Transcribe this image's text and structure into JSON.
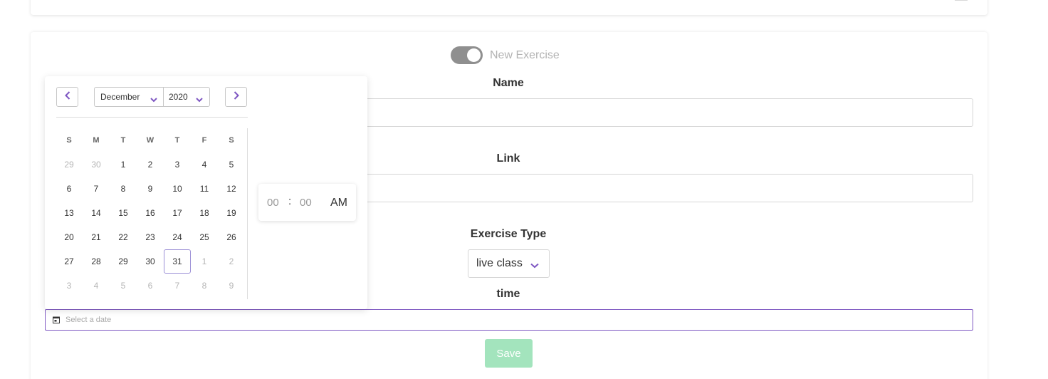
{
  "form": {
    "toggle_label": "New Exercise",
    "name_label": "Name",
    "name_value": "",
    "link_label": "Link",
    "link_value": "",
    "exercise_type_label": "Exercise Type",
    "exercise_type_value": "live class",
    "time_label": "time",
    "date_placeholder": "Select a date",
    "save_label": "Save"
  },
  "datepicker": {
    "month": "December",
    "year": "2020",
    "weekdays": [
      "S",
      "M",
      "T",
      "W",
      "T",
      "F",
      "S"
    ],
    "weeks": [
      [
        "29",
        "30",
        "1",
        "2",
        "3",
        "4",
        "5"
      ],
      [
        "6",
        "7",
        "8",
        "9",
        "10",
        "11",
        "12"
      ],
      [
        "13",
        "14",
        "15",
        "16",
        "17",
        "18",
        "19"
      ],
      [
        "20",
        "21",
        "22",
        "23",
        "24",
        "25",
        "26"
      ],
      [
        "27",
        "28",
        "29",
        "30",
        "31",
        "1",
        "2"
      ],
      [
        "3",
        "4",
        "5",
        "6",
        "7",
        "8",
        "9"
      ]
    ],
    "selected_day": "31",
    "time": {
      "hour": "00",
      "separator": ":",
      "minute": "00",
      "period": "AM"
    }
  },
  "colors": {
    "accent": "#7e57c2",
    "toggle": "#8f8f8f",
    "save_button": "#a3e4bd"
  }
}
